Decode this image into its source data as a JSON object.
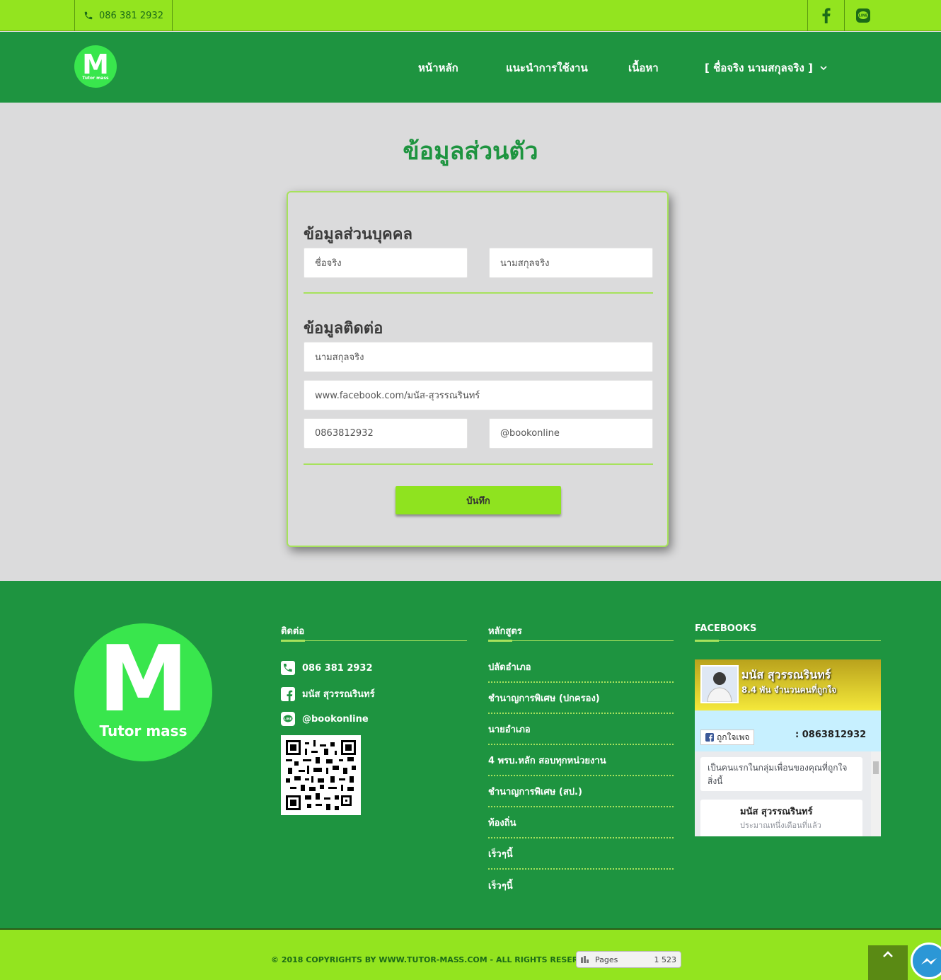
{
  "topbar": {
    "phone": "086 381 2932",
    "facebook_icon": "facebook-icon",
    "line_icon": "line-icon"
  },
  "header": {
    "logo_letter": "M",
    "logo_text": "Tutor mass",
    "nav": [
      "หน้าหลัก",
      "แนะนำการใช้งาน",
      "เนื้อหา",
      "[ ชื่อจริง  นามสกุลจริง ]"
    ]
  },
  "main": {
    "page_title": "ข้อมูลส่วนตัว",
    "personal_heading": "ข้อมูลส่วนบุคคล",
    "first_name": "ชื่อจริง",
    "last_name": "นามสกุลจริง",
    "contact_heading": "ข้อมูลติดต่อ",
    "contact_name": "นามสกุลจริง",
    "facebook": "www.facebook.com/มนัส-สุวรรณรินทร์",
    "phone": "0863812932",
    "line_id": "@bookonline",
    "save_label": "บันทึก"
  },
  "footer": {
    "logo_letter": "M",
    "logo_text": "Tutor mass",
    "contact_heading": "ติดต่อ",
    "contact_phone": "086 381 2932",
    "contact_facebook": "มนัส สุวรรณรินทร์",
    "contact_line": "@bookonline",
    "courses_heading": "หลักสูตร",
    "courses": [
      "ปลัดอำเภอ",
      "ชำนาญการพิเศษ (ปกครอง)",
      "นายอำเภอ",
      "4 พรบ.หลัก สอบทุกหน่วยงาน",
      "ชำนาญการพิเศษ (สป.)",
      "ท้องถิ่น",
      "เร็วๆนี้",
      "เร็วๆนี้"
    ],
    "facebook_heading": "FACEBOOKS",
    "fb_page_name": "มนัส สุวรรณรินทร์",
    "fb_likes": "8.4 พัน จำนวนคนที่ถูกใจ",
    "fb_like_button": "ถูกใจเพจ",
    "fb_phone": ": 0863812932",
    "fb_post1": "เป็นคนแรกในกลุ่มเพื่อนของคุณที่ถูกใจสิ่งนี้",
    "fb_post2_name": "มนัส สุวรรณรินทร์",
    "fb_post2_time": "ประมาณหนึ่งเดือนที่แล้ว"
  },
  "bottom": {
    "copyright": "© 2018 COPYRIGHTS BY WWW.TUTOR-MASS.COM - ALL RIGHTS RESERVED.",
    "counter_label": "Pages",
    "counter_value": "1 523"
  },
  "colors": {
    "lime": "#93e41f",
    "green": "#1e9440",
    "logo_green": "#39e64d",
    "accent_line": "#a7e25c"
  }
}
